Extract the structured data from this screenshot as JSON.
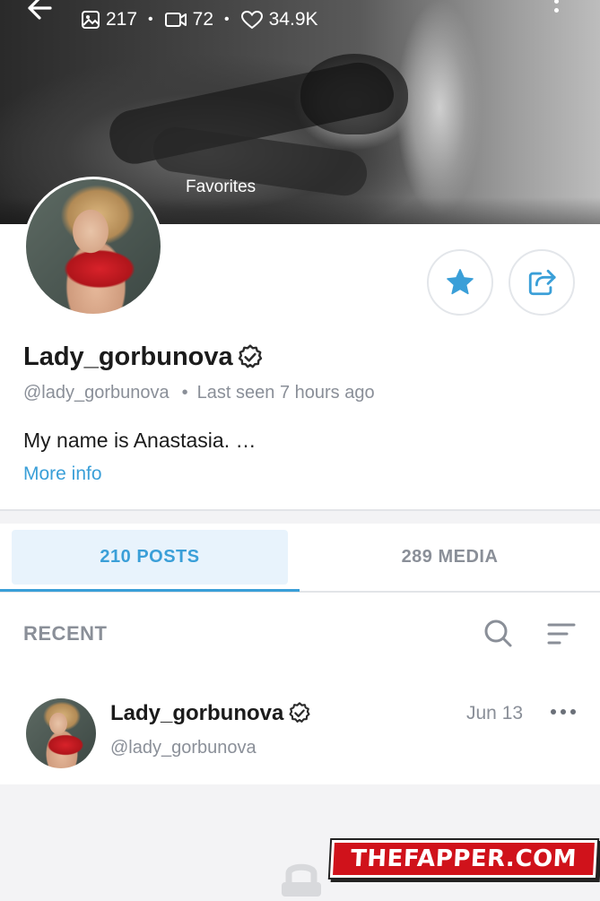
{
  "cover": {
    "stats": {
      "photos": "217",
      "videos": "72",
      "likes": "34.9K"
    },
    "favorites_label": "Favorites"
  },
  "profile": {
    "display_name": "Lady_gorbunova",
    "handle": "@lady_gorbunova",
    "last_seen": "Last seen 7 hours ago",
    "bio": "My name is Anastasia. …",
    "more_info": "More info"
  },
  "tabs": {
    "posts": "210 POSTS",
    "media": "289 MEDIA"
  },
  "feed": {
    "section_label": "RECENT",
    "post": {
      "name": "Lady_gorbunova",
      "handle": "@lady_gorbunova",
      "date": "Jun 13"
    }
  },
  "watermark": "THEFAPPER.COM",
  "colors": {
    "accent": "#3a9fd8",
    "muted": "#8a8f98",
    "watermark_red": "#d0121b"
  },
  "icons": [
    "back-arrow-icon",
    "image-icon",
    "video-icon",
    "heart-icon",
    "more-vertical-icon",
    "star-icon",
    "share-icon",
    "verified-icon",
    "search-icon",
    "sort-icon",
    "more-horizontal-icon",
    "lock-icon"
  ]
}
